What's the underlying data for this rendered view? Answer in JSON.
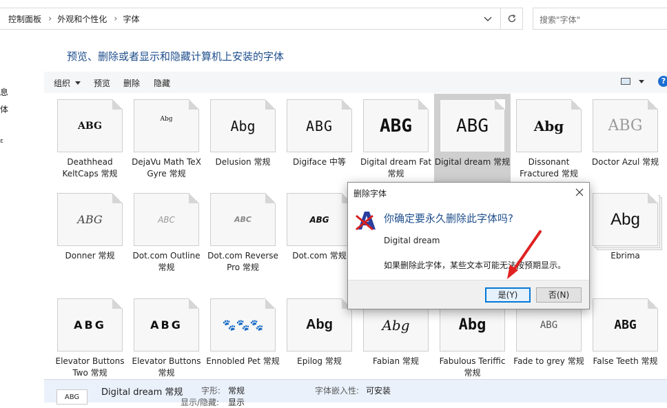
{
  "address_bar": {
    "crumbs": [
      "控制面板",
      "外观和个性化",
      "字体"
    ]
  },
  "search": {
    "placeholder": "搜索\"字体\""
  },
  "left_nav_fragments": [
    "息",
    "体",
    "ε"
  ],
  "heading": "预览、删除或者显示和隐藏计算机上安装的字体",
  "toolbar": {
    "organize": "组织",
    "preview": "预览",
    "delete": "删除",
    "hide": "隐藏",
    "help": "?"
  },
  "fonts": [
    {
      "name": "Deathhead KeltCaps 常规",
      "sample": "ABG"
    },
    {
      "name": "DejaVu Math TeX Gyre 常规",
      "sample": "Abg"
    },
    {
      "name": "Delusion 常规",
      "sample": "Abg"
    },
    {
      "name": "Digiface 中等",
      "sample": "ABG"
    },
    {
      "name": "Digital dream Fat 常规",
      "sample": "ABG"
    },
    {
      "name": "Digital dream 常规",
      "sample": "ABG",
      "selected": true
    },
    {
      "name": "Dissonant Fractured 常规",
      "sample": "Abg"
    },
    {
      "name": "Doctor Azul 常规",
      "sample": "ABG"
    },
    {
      "name": "Donner 常规",
      "sample": "ABG"
    },
    {
      "name": "Dot.com Outline 常规",
      "sample": "ABC"
    },
    {
      "name": "Dot.com Reverse Pro 常规",
      "sample": "ABC"
    },
    {
      "name": "Dot.com 常规",
      "sample": "ABG"
    },
    {
      "name": "Ebrima",
      "sample": "Abg"
    },
    {
      "name": "Elevator Buttons Two 常规",
      "sample": "ABG"
    },
    {
      "name": "Elevator Buttons 常规",
      "sample": "ABG"
    },
    {
      "name": "Ennobled Pet 常规",
      "sample": "🐾🐾🐾"
    },
    {
      "name": "Epilog 常规",
      "sample": "Abg"
    },
    {
      "name": "Fabian 常规",
      "sample": "Abg"
    },
    {
      "name": "Fabulous Teriffic 常规",
      "sample": "Abg"
    },
    {
      "name": "Fade to grey 常规",
      "sample": "ABG"
    },
    {
      "name": "False Teeth 常规",
      "sample": "ABG"
    }
  ],
  "details": {
    "thumb": "ABG",
    "font_name": "Digital dream 常规",
    "style_label": "字形:",
    "style_value": "常规",
    "embed_label": "字体嵌入性:",
    "embed_value": "可安装",
    "showhide_label": "显示/隐藏:",
    "showhide_value": "显示"
  },
  "dialog": {
    "title": "删除字体",
    "question": "你确定要永久删除此字体吗?",
    "font_name": "Digital dream",
    "warning": "如果删除此字体，某些文本可能无法按预期显示。",
    "yes_label": "是(Y)",
    "no_label": "否(N)"
  },
  "colors": {
    "heading": "#1e4e8c",
    "selected_tile": "#cfcfcf",
    "primary_button_border": "#0078d7",
    "pointer_arrow": "#e02020"
  }
}
